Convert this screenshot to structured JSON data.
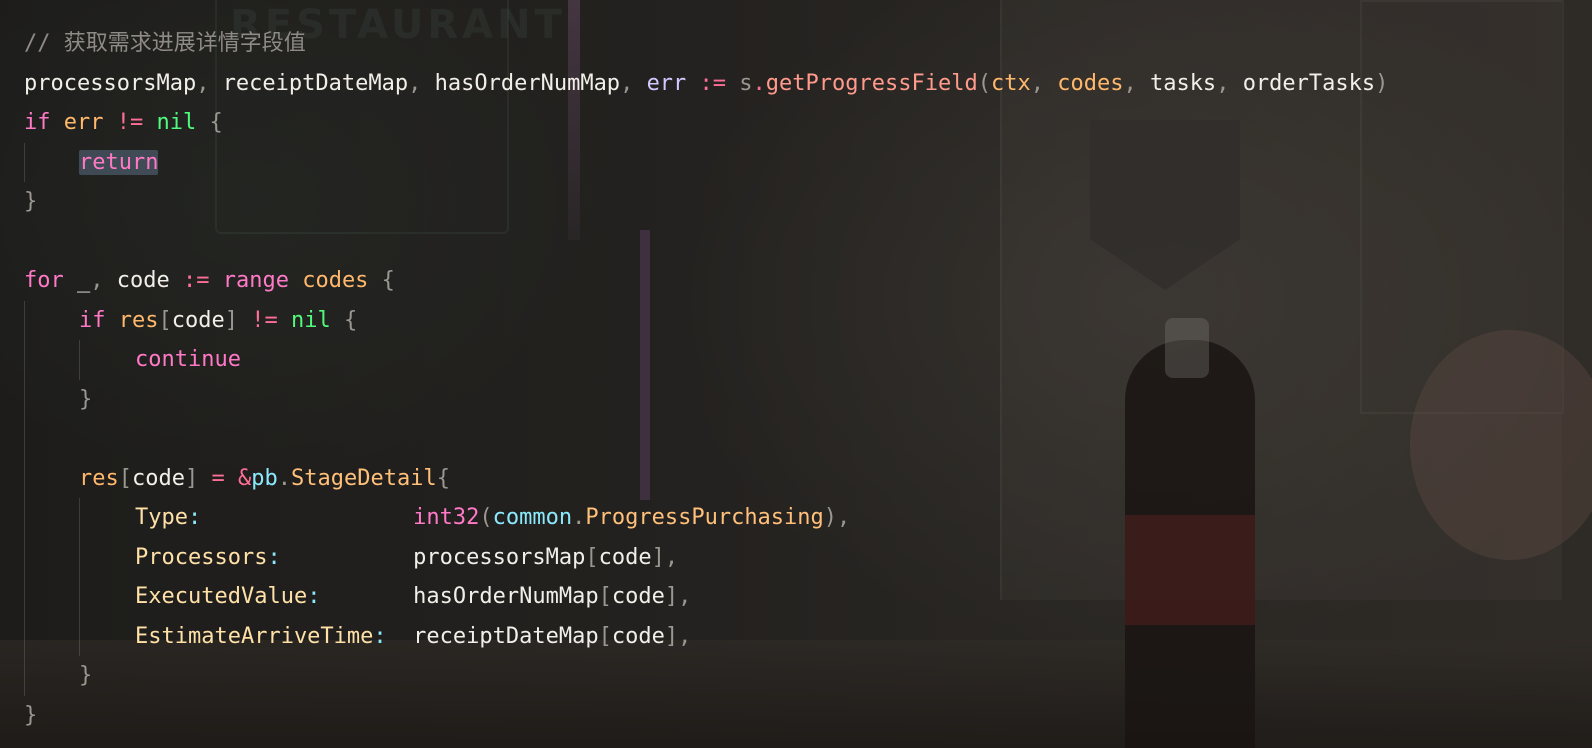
{
  "editor": {
    "lines": [
      {
        "comment": "// ",
        "comment_cjk": "获取需求进展详情字段值"
      },
      {
        "v1": "processorsMap",
        "p1": ", ",
        "v2": "receiptDateMap",
        "p2": ", ",
        "v3": "hasOrderNumMap",
        "p3": ", ",
        "v4": "err",
        "op": " := ",
        "recv": "s",
        "dot": ".",
        "fn": "getProgressField",
        "lp": "(",
        "a1": "ctx",
        "c1": ", ",
        "a2": "codes",
        "c2": ", ",
        "a3": "tasks",
        "c3": ", ",
        "a4": "orderTasks",
        "rp": ")"
      },
      {
        "kw": "if",
        "var": "err",
        "op": " != ",
        "nil": "nil",
        "brace": " {"
      },
      {
        "ret": "return"
      },
      {
        "brace": "}"
      },
      {},
      {
        "kw": "for",
        "blank": " _",
        "comma": ", ",
        "var": "code",
        "op": " := ",
        "range": "range",
        "codes": "codes",
        "brace": " {"
      },
      {
        "kw": "if",
        "res": "res",
        "lb": "[",
        "code": "code",
        "rb": "]",
        "op": " != ",
        "nil": "nil",
        "brace": " {"
      },
      {
        "kw": "continue"
      },
      {
        "brace": "}"
      },
      {},
      {
        "res": "res",
        "lb": "[",
        "code": "code",
        "rb": "]",
        "eq": " = ",
        "amp": "&",
        "pkg": "pb",
        "dot": ".",
        "type": "StageDetail",
        "brace": "{"
      },
      {
        "field": "Type",
        "colon": ":",
        "pad": "                ",
        "fn": "int32",
        "lp": "(",
        "pkg": "common",
        "dot": ".",
        "const": "ProgressPurchasing",
        "rp": ")",
        "comma": ","
      },
      {
        "field": "Processors",
        "colon": ":",
        "pad": "          ",
        "map": "processorsMap",
        "lb": "[",
        "code": "code",
        "rb": "]",
        "comma": ","
      },
      {
        "field": "ExecutedValue",
        "colon": ":",
        "pad": "       ",
        "map": "hasOrderNumMap",
        "lb": "[",
        "code": "code",
        "rb": "]",
        "comma": ","
      },
      {
        "field": "EstimateArriveTime",
        "colon": ":",
        "pad": "  ",
        "map": "receiptDateMap",
        "lb": "[",
        "code": "code",
        "rb": "]",
        "comma": ","
      },
      {
        "brace": "}"
      },
      {
        "brace": "}"
      }
    ]
  }
}
